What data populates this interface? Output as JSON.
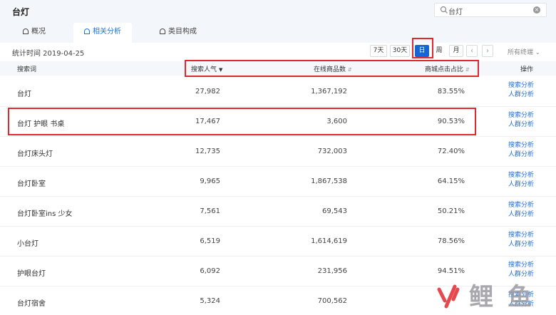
{
  "page": {
    "title": "台灯",
    "search": {
      "value": "台灯",
      "icon": "search-icon",
      "clear_icon": "clear-icon"
    }
  },
  "tabs": [
    {
      "label": "概况",
      "icon": "home-icon",
      "active": false
    },
    {
      "label": "相关分析",
      "icon": "home-icon",
      "active": true
    },
    {
      "label": "类目构成",
      "icon": "home-icon",
      "active": false
    }
  ],
  "toolbar": {
    "stat_time": "统计时间 2019-04-25",
    "ranges": [
      "7天",
      "30天",
      "日",
      "周",
      "月"
    ],
    "active_range": "日",
    "prev_icon": "chevron-left-icon",
    "next_icon": "chevron-right-icon",
    "terminal": "所有终端"
  },
  "table": {
    "headers": {
      "term": "搜索词",
      "popularity": "搜索人气",
      "goods": "在线商品数",
      "ctr": "商城点击占比",
      "ops": "操作"
    },
    "op_labels": [
      "搜索分析",
      "人群分析"
    ],
    "rows": [
      {
        "term": "台灯",
        "popularity": "27,982",
        "goods": "1,367,192",
        "ctr": "83.55%"
      },
      {
        "term": "台灯 护眼 书桌",
        "popularity": "17,467",
        "goods": "3,600",
        "ctr": "90.53%"
      },
      {
        "term": "台灯床头灯",
        "popularity": "12,735",
        "goods": "732,003",
        "ctr": "72.40%"
      },
      {
        "term": "台灯卧室",
        "popularity": "9,965",
        "goods": "1,867,538",
        "ctr": "64.15%"
      },
      {
        "term": "台灯卧室ins 少女",
        "popularity": "7,561",
        "goods": "69,543",
        "ctr": "50.21%"
      },
      {
        "term": "小台灯",
        "popularity": "6,519",
        "goods": "1,614,619",
        "ctr": "78.56%"
      },
      {
        "term": "护眼台灯",
        "popularity": "6,092",
        "goods": "231,956",
        "ctr": "94.51%"
      },
      {
        "term": "台灯宿舍",
        "popularity": "5,324",
        "goods": "700,562",
        "ctr": ""
      }
    ]
  },
  "watermark": {
    "text": "火鲤鱼"
  },
  "colors": {
    "accent": "#1565d8",
    "highlight": "#e0292f",
    "link": "#1d6fdc"
  }
}
